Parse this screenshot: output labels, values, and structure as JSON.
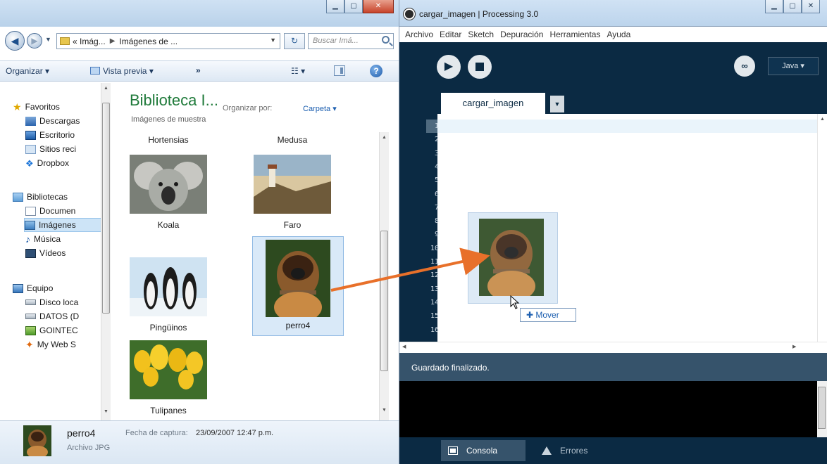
{
  "explorer": {
    "address": {
      "part1": "« Imág...",
      "part2": "Imágenes de ..."
    },
    "search": {
      "placeholder": "Buscar Imá..."
    },
    "toolbar": {
      "organize": "Organizar ▾",
      "preview": "Vista previa ▾",
      "more": "»",
      "views": "☷ ▾"
    },
    "nav": {
      "favorites": "Favoritos",
      "downloads": "Descargas",
      "desktop": "Escritorio",
      "recent": "Sitios reci",
      "dropbox": "Dropbox",
      "libraries": "Bibliotecas",
      "documents": "Documen",
      "images": "Imágenes",
      "music": "Música",
      "videos": "Vídeos",
      "computer": "Equipo",
      "disk_local": "Disco loca",
      "datos": "DATOS (D",
      "gointec": "GOINTEC",
      "myweb": "My Web S"
    },
    "library": {
      "title": "Biblioteca I...",
      "subtitle": "Imágenes de muestra",
      "arrange_label": "Organizar por:",
      "arrange_value": "Carpeta ▾"
    },
    "files": {
      "hortensias": "Hortensias",
      "medusa": "Medusa",
      "koala": "Koala",
      "faro": "Faro",
      "pinguinos": "Pingüinos",
      "perro4": "perro4",
      "tulipanes": "Tulipanes"
    },
    "details": {
      "name": "perro4",
      "type": "Archivo JPG",
      "date_label": "Fecha de captura:",
      "date_value": "23/09/2007 12:47 p.m."
    }
  },
  "processing": {
    "title": "cargar_imagen | Processing 3.0",
    "menu": [
      "Archivo",
      "Editar",
      "Sketch",
      "Depuración",
      "Herramientas",
      "Ayuda"
    ],
    "mode": "Java ▾",
    "tab_name": "cargar_imagen",
    "line_numbers": [
      "1",
      "2",
      "3",
      "4",
      "5",
      "6",
      "7",
      "8",
      "9",
      "10",
      "11",
      "12",
      "13",
      "14",
      "15",
      "16"
    ],
    "status": "Guardado finalizado.",
    "footer": {
      "console": "Consola",
      "errors": "Errores"
    }
  },
  "drag": {
    "tooltip": "✚ Mover"
  },
  "colors": {
    "processing_bg": "#0b2a43",
    "status_bar": "#36536b",
    "library_title": "#1f7a3a",
    "arrow": "#e8702a"
  }
}
